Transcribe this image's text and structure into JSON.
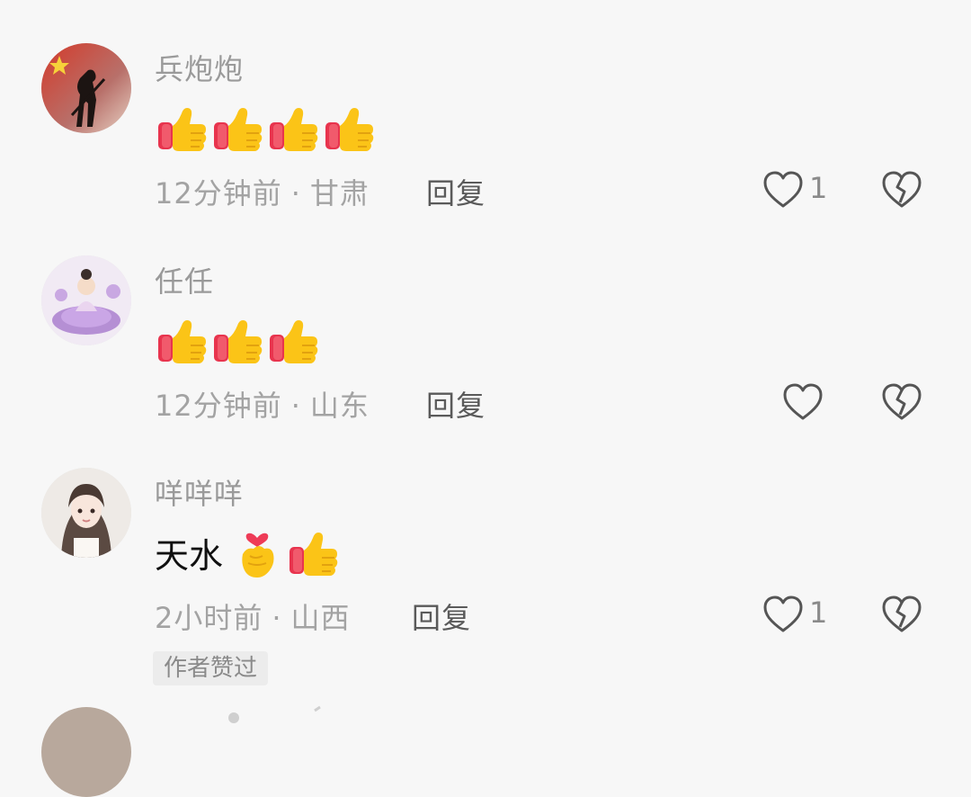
{
  "comments": [
    {
      "username": "兵炮炮",
      "content_text": "",
      "emojis": [
        "thumbs-up",
        "thumbs-up",
        "thumbs-up",
        "thumbs-up"
      ],
      "time": "12分钟前",
      "location": "甘肃",
      "reply_label": "回复",
      "like_count": "1"
    },
    {
      "username": "任任",
      "content_text": "",
      "emojis": [
        "thumbs-up",
        "thumbs-up",
        "thumbs-up"
      ],
      "time": "12分钟前",
      "location": "山东",
      "reply_label": "回复",
      "like_count": ""
    },
    {
      "username": "咩咩咩",
      "content_text": "天水",
      "emojis": [
        "heart-hands",
        "thumbs-up"
      ],
      "time": "2小时前",
      "location": "山西",
      "reply_label": "回复",
      "like_count": "1",
      "badge": "作者赞过"
    }
  ],
  "separator": "·",
  "colors": {
    "meta": "#a3a3a3",
    "username": "#9a9a9a",
    "reply": "#5a5a5a",
    "icon_stroke": "#555555"
  }
}
